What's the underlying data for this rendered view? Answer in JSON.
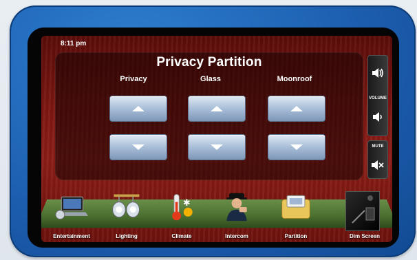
{
  "status_bar": {
    "time": "8:11 pm"
  },
  "panel": {
    "title": "Privacy Partition",
    "columns": [
      {
        "label": "Privacy"
      },
      {
        "label": "Glass"
      },
      {
        "label": "Moonroof"
      }
    ]
  },
  "volume": {
    "label": "VOLUME",
    "up_icon": "speaker-loud-icon",
    "down_icon": "speaker-soft-icon"
  },
  "mute": {
    "label": "MUTE",
    "icon": "speaker-mute-icon"
  },
  "dock": {
    "items": [
      {
        "label": "Entertainment",
        "icon": "laptop-icon"
      },
      {
        "label": "Lighting",
        "icon": "spotlight-icon"
      },
      {
        "label": "Climate",
        "icon": "thermometer-icon"
      },
      {
        "label": "Intercom",
        "icon": "chauffeur-icon"
      },
      {
        "label": "Partition",
        "icon": "partition-icon"
      },
      {
        "label": "Dim Screen",
        "icon": "dim-screen-icon"
      }
    ]
  },
  "colors": {
    "bezel": "#1d5fb0",
    "wood": "#7e1712",
    "button": "#a8bed8"
  }
}
